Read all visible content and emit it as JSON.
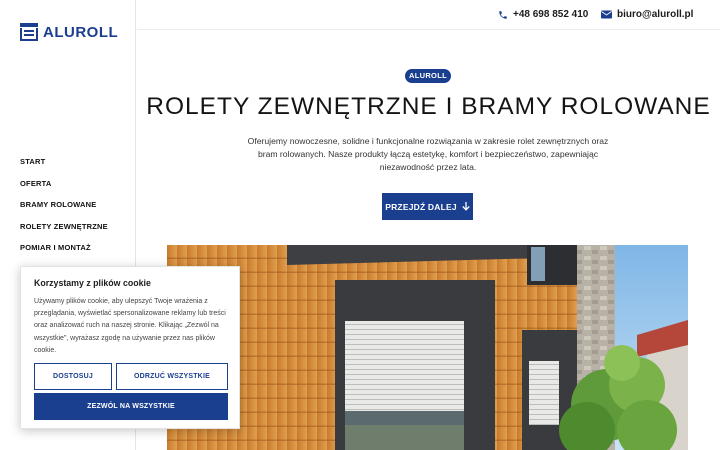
{
  "brand": {
    "name": "ALUROLL",
    "color": "#1b3f8f"
  },
  "nav": {
    "items": [
      {
        "label": "START"
      },
      {
        "label": "OFERTA"
      },
      {
        "label": "BRAMY ROLOWANE"
      },
      {
        "label": "ROLETY ZEWNĘTRZNE"
      },
      {
        "label": "POMIAR I MONTAŻ"
      }
    ]
  },
  "contact": {
    "phone": "+48 698 852 410",
    "phone_icon": "phone-icon",
    "email": "biuro@aluroll.pl",
    "email_icon": "envelope-icon"
  },
  "hero": {
    "badge": "ALUROLL",
    "title": "ROLETY ZEWNĘTRZNE I BRAMY ROLOWANE",
    "description": "Oferujemy nowoczesne, solidne i funkcjonalne rozwiązania w zakresie rolet zewnętrznych oraz bram rolowanych. Nasze produkty łączą estetykę, komfort i bezpieczeństwo, zapewniając niezawodność przez lata.",
    "cta_label": "PRZEJDŹ DALEJ",
    "cta_icon": "arrow-down-icon"
  },
  "cookie": {
    "title": "Korzystamy z plików cookie",
    "text": "Używamy plików cookie, aby ulepszyć Twoje wrażenia z przeglądania, wyświetlać spersonalizowane reklamy lub treści oraz analizować ruch na naszej stronie. Klikając „Zezwól na wszystkie”, wyrażasz zgodę na używanie przez nas plików cookie.",
    "customize_label": "DOSTOSUJ",
    "reject_label": "ODRZUĆ WSZYSTKIE",
    "accept_label": "ZEZWÓL NA WSZYSTKIE"
  }
}
